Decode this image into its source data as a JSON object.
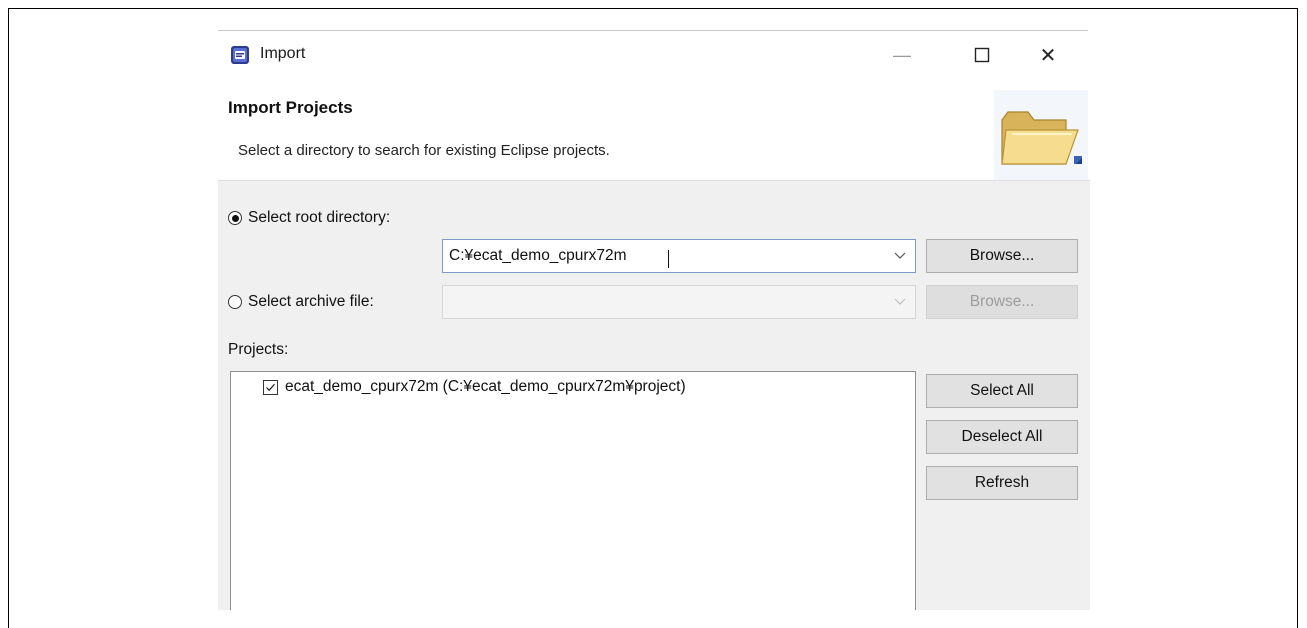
{
  "window": {
    "title": "Import",
    "minimize_glyph": "—",
    "close_glyph": "✕"
  },
  "header": {
    "title": "Import Projects",
    "description": "Select a directory to search for existing Eclipse projects."
  },
  "root_directory": {
    "label": "Select root directory:",
    "selected": true,
    "value": "C:¥ecat_demo_cpurx72m",
    "browse_label": "Browse..."
  },
  "archive_file": {
    "label": "Select archive file:",
    "selected": false,
    "value": "",
    "browse_label": "Browse..."
  },
  "projects": {
    "label": "Projects:",
    "items": [
      {
        "label": "ecat_demo_cpurx72m (C:¥ecat_demo_cpurx72m¥project)",
        "checked": true
      }
    ]
  },
  "actions": {
    "select_all_label": "Select All",
    "deselect_all_label": "Deselect All",
    "refresh_label": "Refresh"
  },
  "colors": {
    "focus_border": "#7a9cc6",
    "button_bg": "#e1e1e1",
    "body_bg": "#f0f0f0"
  }
}
